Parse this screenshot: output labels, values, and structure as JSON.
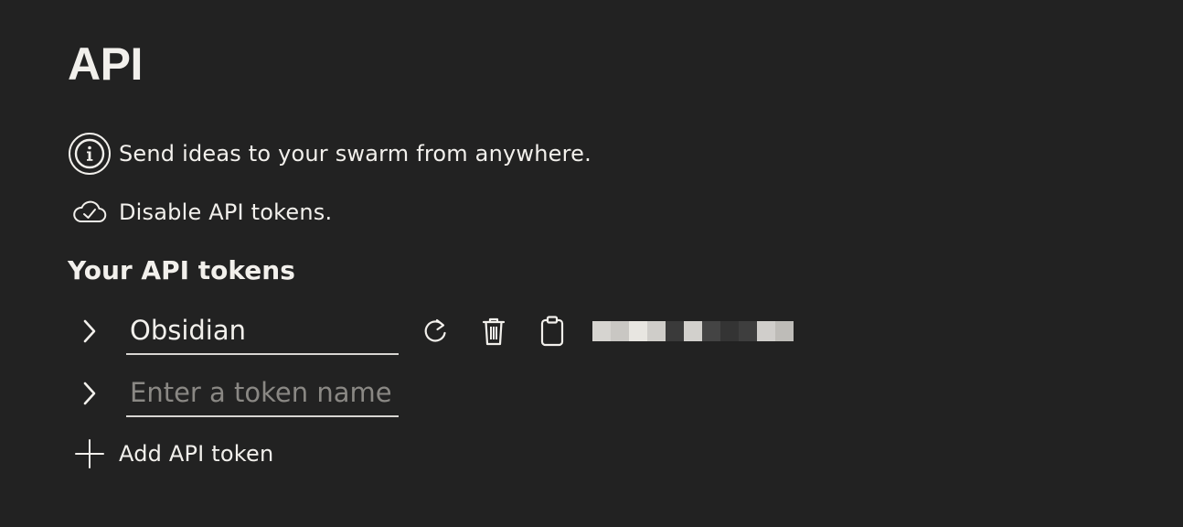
{
  "page": {
    "title": "API"
  },
  "info": {
    "icon": "info-icon",
    "text": "Send ideas to your swarm from anywhere."
  },
  "toggle": {
    "icon": "cloud-check-icon",
    "text": "Disable API tokens."
  },
  "tokens_section": {
    "title": "Your API tokens",
    "tokens": [
      {
        "name": "Obsidian",
        "placeholder": "Enter a token name",
        "actions": [
          "refresh-icon",
          "trash-icon",
          "clipboard-icon"
        ],
        "value_hidden": true
      },
      {
        "name": "",
        "placeholder": "Enter a token name"
      }
    ],
    "add_label": "Add API token"
  },
  "colors": {
    "background": "#222222",
    "text": "#f2f0ec",
    "placeholder": "#8a8884",
    "underline": "#d8d6d2"
  }
}
